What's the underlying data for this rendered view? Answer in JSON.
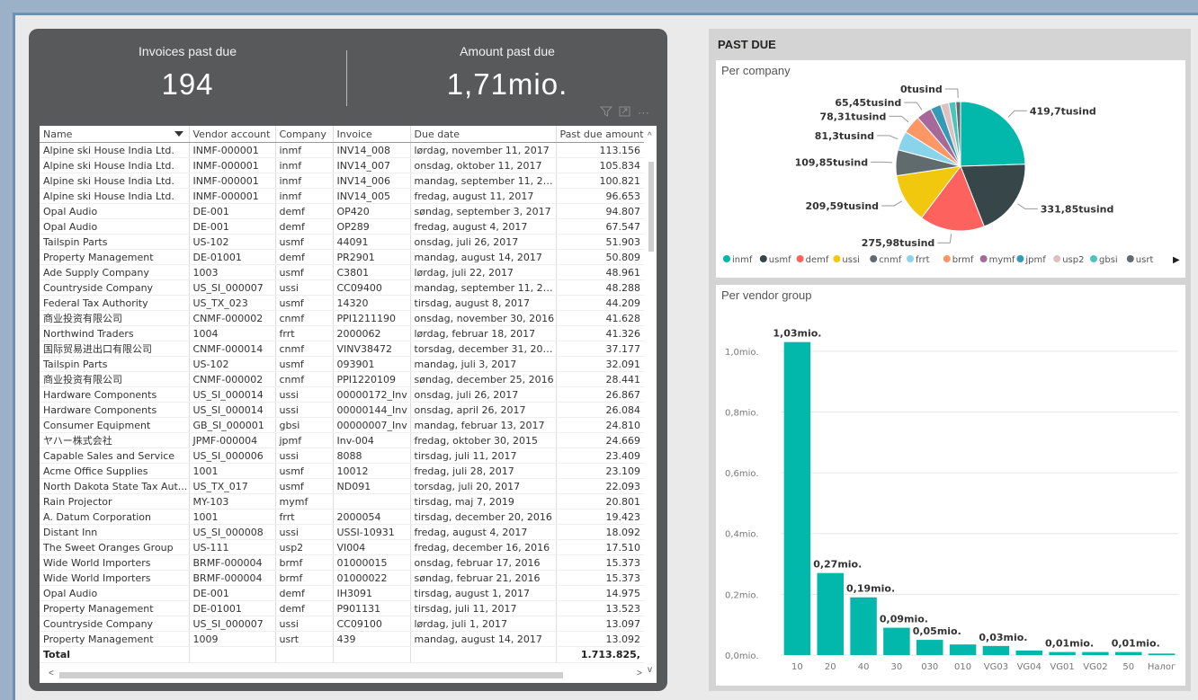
{
  "kpis": {
    "invoices_label": "Invoices past due",
    "invoices_value": "194",
    "amount_label": "Amount past due",
    "amount_value": "1,71mio."
  },
  "table": {
    "columns": [
      "Name",
      "Vendor account",
      "Company",
      "Invoice",
      "Due date",
      "Past due amount"
    ],
    "rows": [
      [
        "Alpine ski House India Ltd.",
        "INMF-000001",
        "inmf",
        "INV14_008",
        "lørdag, november 11, 2017",
        "113.156"
      ],
      [
        "Alpine ski House India Ltd.",
        "INMF-000001",
        "inmf",
        "INV14_007",
        "onsdag, oktober 11, 2017",
        "105.834"
      ],
      [
        "Alpine ski House India Ltd.",
        "INMF-000001",
        "inmf",
        "INV14_006",
        "mandag, september 11, 2017",
        "100.821"
      ],
      [
        "Alpine ski House India Ltd.",
        "INMF-000001",
        "inmf",
        "INV14_005",
        "fredag, august 11, 2017",
        "96.653"
      ],
      [
        "Opal Audio",
        "DE-001",
        "demf",
        "OP420",
        "søndag, september 3, 2017",
        "94.807"
      ],
      [
        "Opal Audio",
        "DE-001",
        "demf",
        "OP289",
        "fredag, august 4, 2017",
        "67.547"
      ],
      [
        "Tailspin Parts",
        "US-102",
        "usmf",
        "44091",
        "onsdag, juli 26, 2017",
        "51.903"
      ],
      [
        "Property Management",
        "DE-01001",
        "demf",
        "PR2901",
        "mandag, august 14, 2017",
        "50.809"
      ],
      [
        "Ade Supply Company",
        "1003",
        "usmf",
        "C3801",
        "lørdag, juli 22, 2017",
        "48.961"
      ],
      [
        "Countryside Company",
        "US_SI_000007",
        "ussi",
        "CC09400",
        "mandag, september 11, 2017",
        "48.288"
      ],
      [
        "Federal Tax Authority",
        "US_TX_023",
        "usmf",
        "14320",
        "tirsdag, august 8, 2017",
        "44.209"
      ],
      [
        "商业投资有限公司",
        "CNMF-000002",
        "cnmf",
        "PPI1211190",
        "onsdag, november 30, 2016",
        "41.628"
      ],
      [
        "Northwind Traders",
        "1004",
        "frrt",
        "2000062",
        "lørdag, februar 18, 2017",
        "41.326"
      ],
      [
        "国际贸易进出口有限公司",
        "CNMF-000014",
        "cnmf",
        "VINV38472",
        "torsdag, december 31, 2015",
        "37.177"
      ],
      [
        "Tailspin Parts",
        "US-102",
        "usmf",
        "093901",
        "mandag, juli 3, 2017",
        "32.091"
      ],
      [
        "商业投资有限公司",
        "CNMF-000002",
        "cnmf",
        "PPI1220109",
        "søndag, december 25, 2016",
        "28.441"
      ],
      [
        "Hardware Components",
        "US_SI_000014",
        "ussi",
        "00000172_Inv",
        "onsdag, juli 26, 2017",
        "26.867"
      ],
      [
        "Hardware Components",
        "US_SI_000014",
        "ussi",
        "00000144_Inv",
        "onsdag, april 26, 2017",
        "26.084"
      ],
      [
        "Consumer Equipment",
        "GB_SI_000001",
        "gbsi",
        "00000007_Inv",
        "mandag, februar 13, 2017",
        "24.810"
      ],
      [
        "ヤハー株式会社",
        "JPMF-000004",
        "jpmf",
        "Inv-004",
        "fredag, oktober 30, 2015",
        "24.669"
      ],
      [
        "Capable Sales and Service",
        "US_SI_000006",
        "ussi",
        "8088",
        "tirsdag, juli 11, 2017",
        "23.409"
      ],
      [
        "Acme Office Supplies",
        "1001",
        "usmf",
        "10012",
        "fredag, juli 28, 2017",
        "23.109"
      ],
      [
        "North Dakota State Tax Aut...",
        "US_TX_017",
        "usmf",
        "ND091",
        "torsdag, juli 20, 2017",
        "22.093"
      ],
      [
        "Rain Projector",
        "MY-103",
        "mymf",
        "",
        "tirsdag, maj 7, 2019",
        "20.801"
      ],
      [
        "A. Datum Corporation",
        "1001",
        "frrt",
        "2000054",
        "tirsdag, december 20, 2016",
        "19.423"
      ],
      [
        "Distant Inn",
        "US_SI_000008",
        "ussi",
        "USSI-10931",
        "fredag, august 4, 2017",
        "18.092"
      ],
      [
        "The Sweet Oranges Group",
        "US-111",
        "usp2",
        "VI004",
        "fredag, december 16, 2016",
        "17.510"
      ],
      [
        "Wide World Importers",
        "BRMF-000004",
        "brmf",
        "01000015",
        "onsdag, februar 17, 2016",
        "15.373"
      ],
      [
        "Wide World Importers",
        "BRMF-000004",
        "brmf",
        "01000022",
        "søndag, februar 21, 2016",
        "15.373"
      ],
      [
        "Opal Audio",
        "DE-001",
        "demf",
        "IH3091",
        "tirsdag, august 1, 2017",
        "14.975"
      ],
      [
        "Property Management",
        "DE-01001",
        "demf",
        "P901131",
        "tirsdag, juli 11, 2017",
        "13.523"
      ],
      [
        "Countryside Company",
        "US_SI_000007",
        "ussi",
        "CC09100",
        "lørdag, juli 1, 2017",
        "13.097"
      ],
      [
        "Property Management",
        "1009",
        "usrt",
        "439",
        "mandag, august 14, 2017",
        "13.092"
      ]
    ],
    "total_label": "Total",
    "total_value": "1.713.825,"
  },
  "past_due_title": "PAST DUE",
  "company_chart": {
    "title": "Per company",
    "legend_more": "▶"
  },
  "vendor_chart": {
    "title": "Per vendor group"
  },
  "chart_data": [
    {
      "type": "pie",
      "title": "Per company",
      "legend_position": "bottom",
      "slices": [
        {
          "name": "inmf",
          "label": "419,7tusind",
          "value": 416.46,
          "color": "#01b8aa"
        },
        {
          "name": "usmf",
          "label": "331,85tusind",
          "value": 331.85,
          "color": "#374649"
        },
        {
          "name": "demf",
          "label": "275,98tusind",
          "value": 275.98,
          "color": "#fd625e"
        },
        {
          "name": "ussi",
          "label": "209,59tusind",
          "value": 209.59,
          "color": "#f2c80f"
        },
        {
          "name": "cnmf",
          "label": "109,85tusind",
          "value": 109.85,
          "color": "#5f6b6d"
        },
        {
          "name": "frrt",
          "label": "81,3tusind",
          "value": 81.3,
          "color": "#8ad4eb"
        },
        {
          "name": "brmf",
          "label": "78,31tusind",
          "value": 78.31,
          "color": "#fe9666"
        },
        {
          "name": "mymf",
          "label": "65,45tusind",
          "value": 65.45,
          "color": "#a66999"
        },
        {
          "name": "jpmf",
          "label": "",
          "value": 45.0,
          "color": "#3599b8"
        },
        {
          "name": "usp2",
          "label": "",
          "value": 35.0,
          "color": "#dfbfbf"
        },
        {
          "name": "gbsi",
          "label": "",
          "value": 30.0,
          "color": "#4ac5bb"
        },
        {
          "name": "usrt",
          "label": "0tusind",
          "value": 20.0,
          "color": "#5f6b6d"
        }
      ]
    },
    {
      "type": "bar",
      "title": "Per vendor group",
      "categories": [
        "10",
        "20",
        "40",
        "30",
        "030",
        "010",
        "VG03",
        "VG04",
        "VG01",
        "VG02",
        "50",
        "Налог"
      ],
      "values": [
        1.03,
        0.27,
        0.19,
        0.09,
        0.05,
        0.035,
        0.03,
        0.015,
        0.01,
        0.01,
        0.01,
        0.005
      ],
      "data_labels": [
        "1,03mio.",
        "0,27mio.",
        "0,19mio.",
        "0,09mio.",
        "0,05mio.",
        "",
        "0,03mio.",
        "",
        "0,01mio.",
        "",
        "0,01mio.",
        ""
      ],
      "yticks": [
        "0,0mio.",
        "0,2mio.",
        "0,4mio.",
        "0,6mio.",
        "0,8mio.",
        "1,0mio."
      ],
      "ylim": [
        0,
        1.1
      ],
      "color": "#01b8aa",
      "grid": true
    }
  ]
}
